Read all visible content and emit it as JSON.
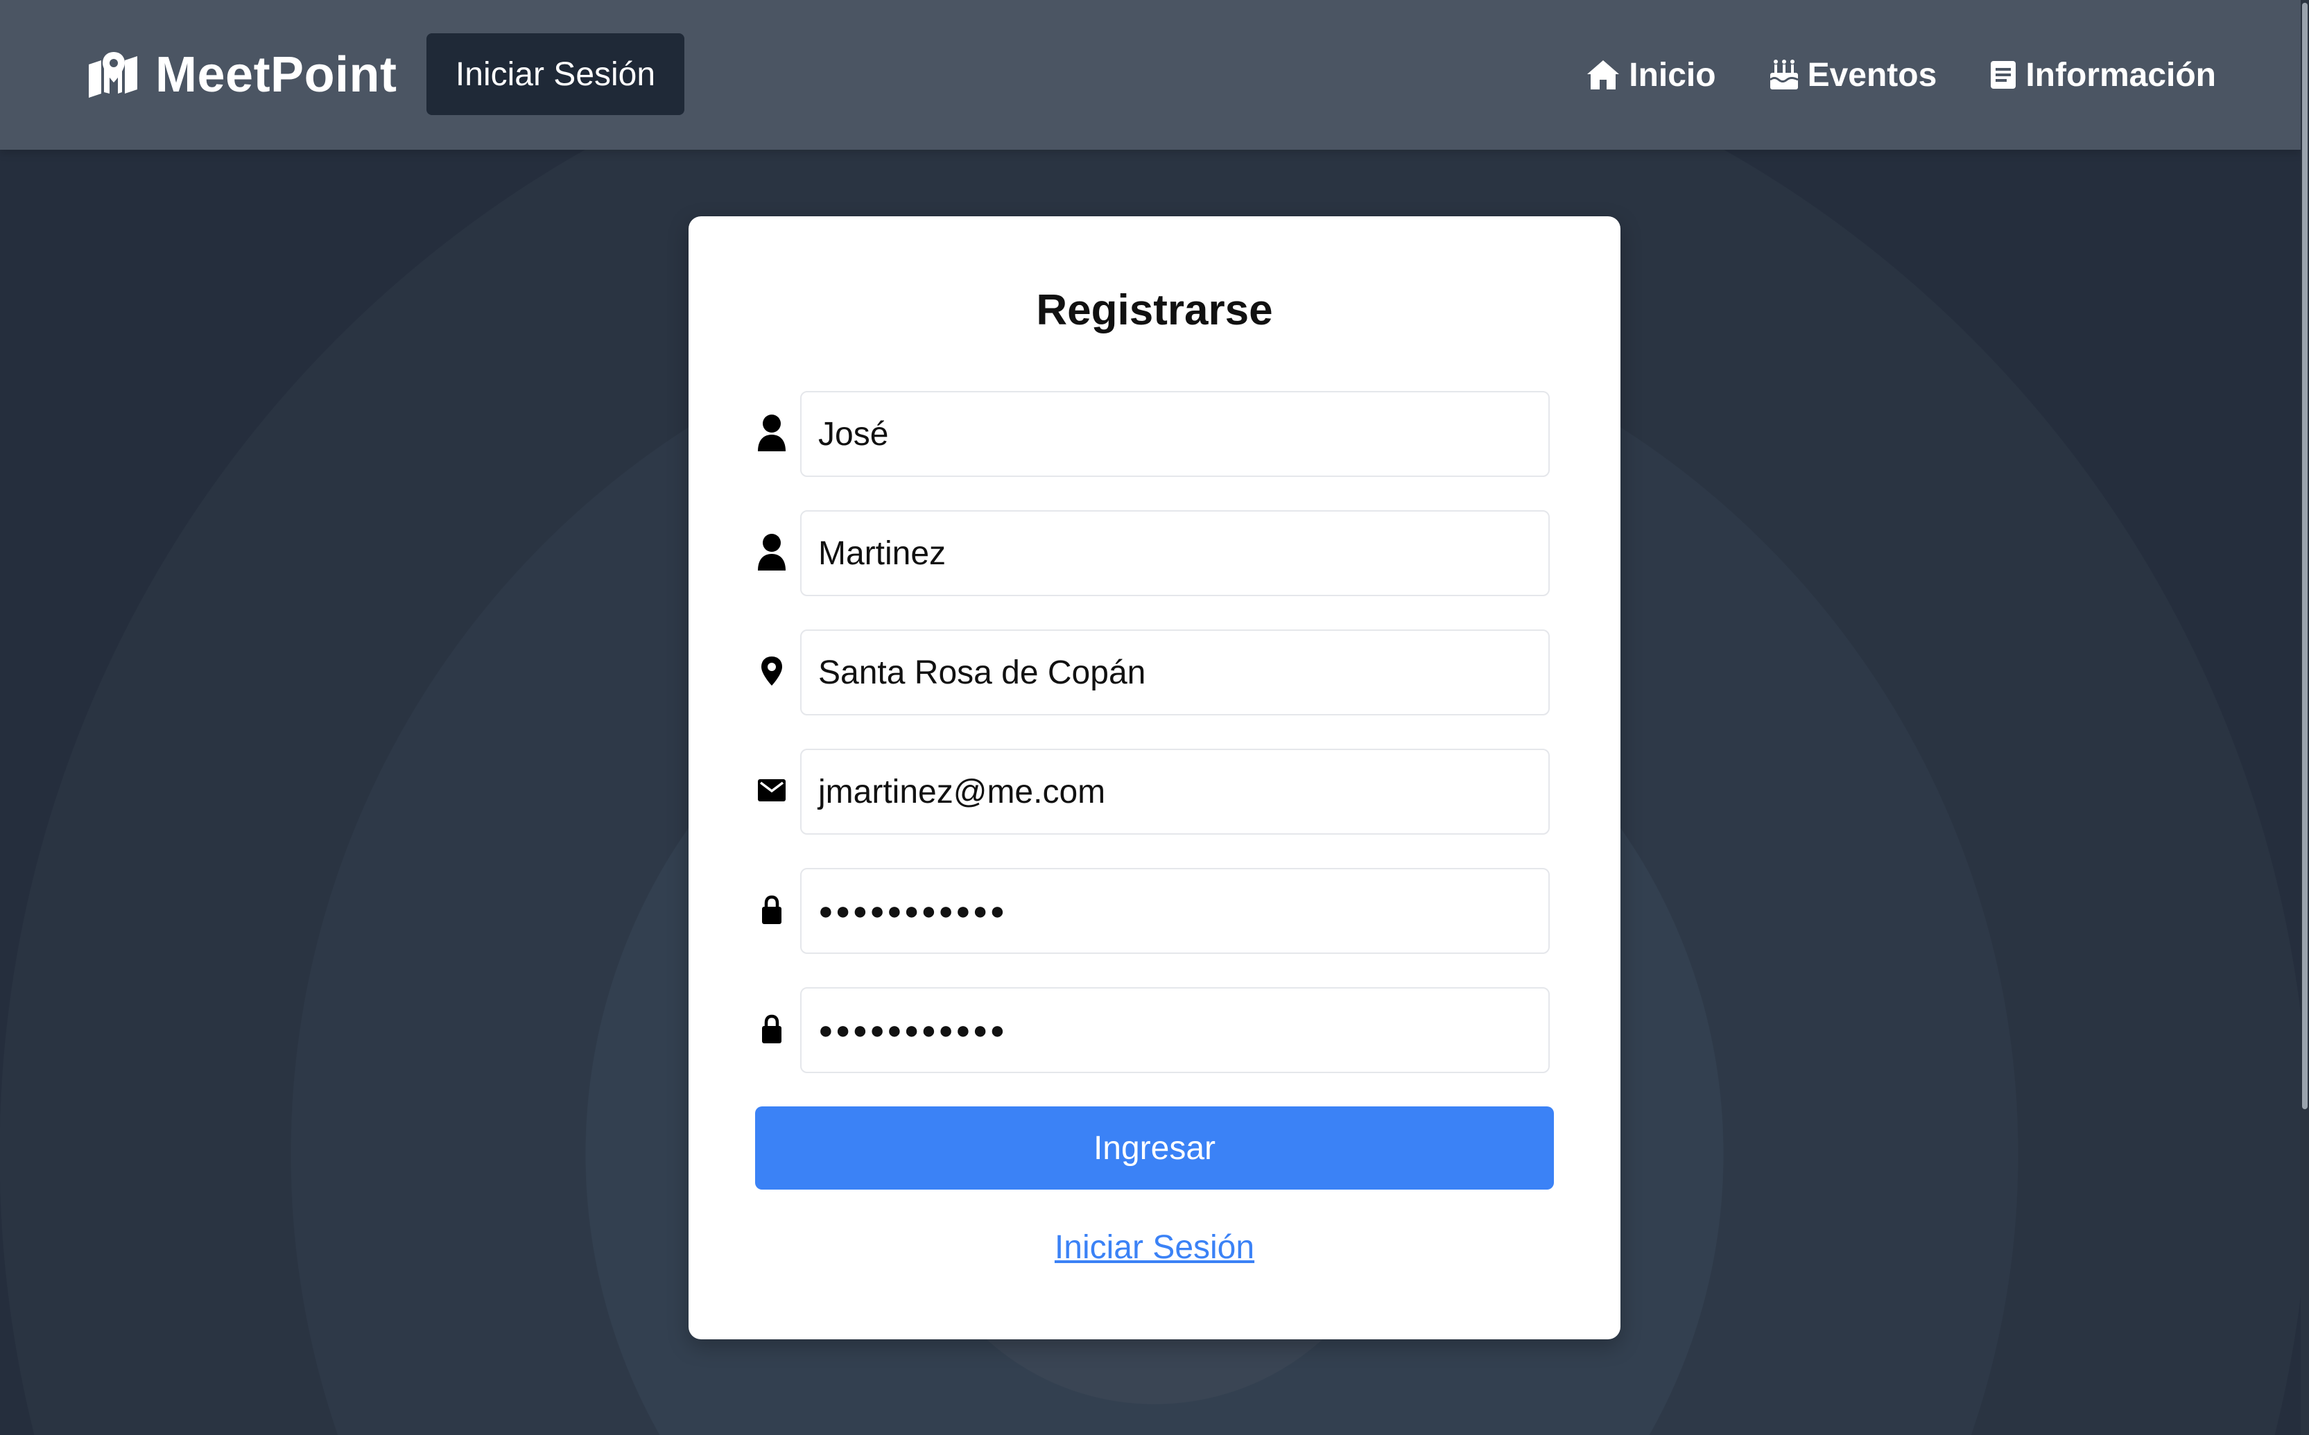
{
  "navbar": {
    "brand": "MeetPoint",
    "brand_icon": "map-pin-icon",
    "login_button": "Iniciar Sesión",
    "links": [
      {
        "label": "Inicio",
        "icon": "home-icon"
      },
      {
        "label": "Eventos",
        "icon": "cake-icon"
      },
      {
        "label": "Información",
        "icon": "document-icon"
      }
    ]
  },
  "form": {
    "title": "Registrarse",
    "fields": [
      {
        "icon": "user-icon",
        "value": "José"
      },
      {
        "icon": "user-icon",
        "value": "Martinez"
      },
      {
        "icon": "location-pin-icon",
        "value": "Santa Rosa de Copán"
      },
      {
        "icon": "envelope-icon",
        "value": "jmartinez@me.com"
      },
      {
        "icon": "lock-icon",
        "value": "●●●●●●●●●●●"
      },
      {
        "icon": "lock-icon",
        "value": "●●●●●●●●●●●"
      }
    ],
    "submit_label": "Ingresar",
    "login_link": "Iniciar Sesión"
  },
  "colors": {
    "navbar": "#4b5563",
    "background": "#252e3d",
    "primary": "#3b82f6",
    "dark_button": "#1f2937"
  }
}
